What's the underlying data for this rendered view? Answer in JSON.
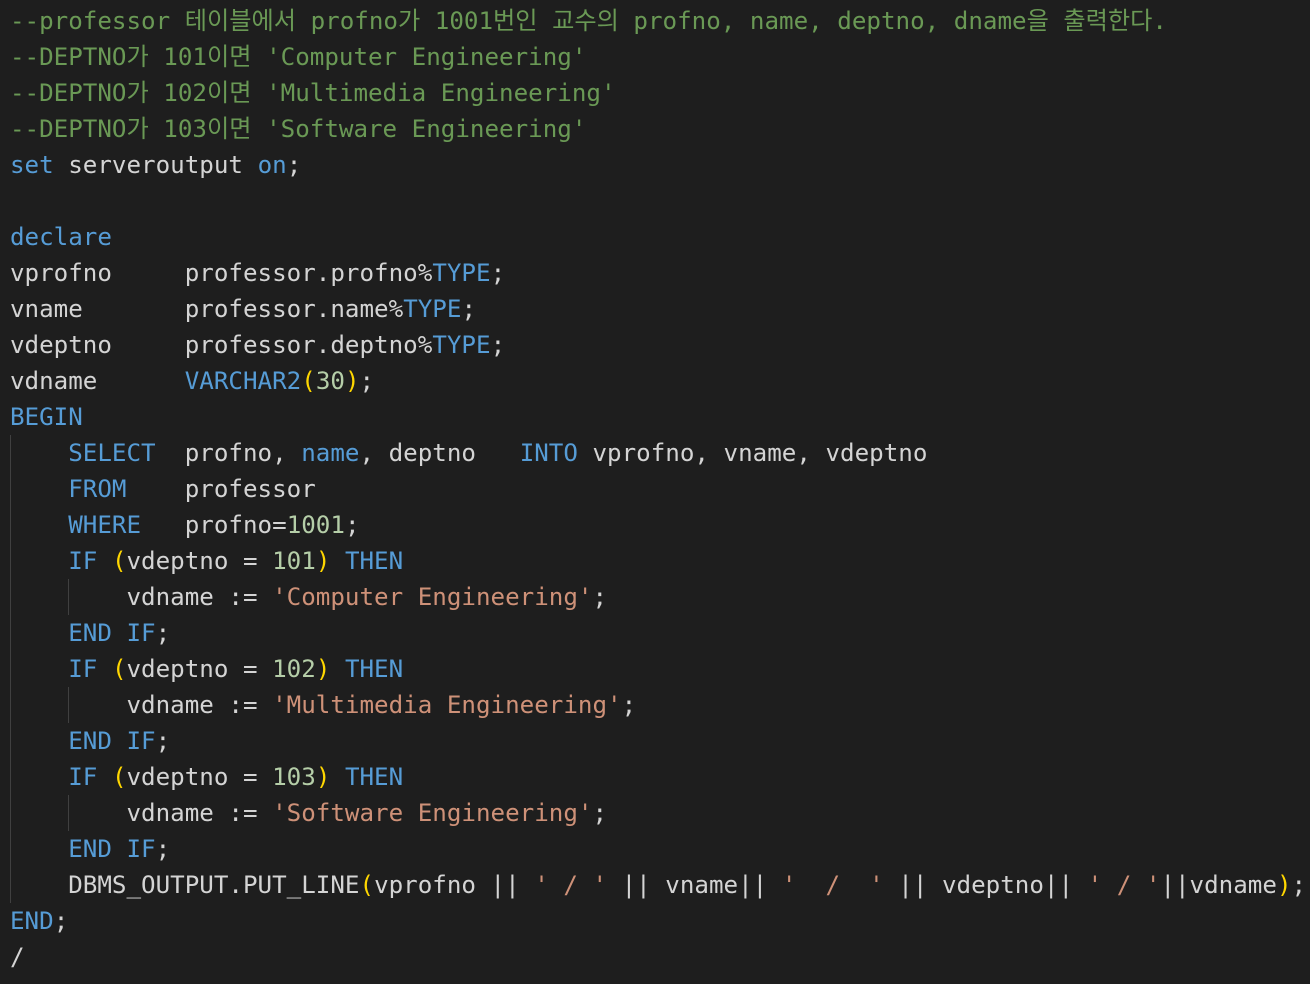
{
  "lines": [
    [
      {
        "t": "--professor 테이블에서 profno가 1001번인 교수의 profno, name, deptno, dname을 출력한다.",
        "k": "comment"
      }
    ],
    [
      {
        "t": "--DEPTNO가 101이면 'Computer Engineering'",
        "k": "comment"
      }
    ],
    [
      {
        "t": "--DEPTNO가 102이면 'Multimedia Engineering'",
        "k": "comment"
      }
    ],
    [
      {
        "t": "--DEPTNO가 103이면 'Software Engineering'",
        "k": "comment"
      }
    ],
    [
      {
        "t": "set",
        "k": "kw"
      },
      {
        "t": " serveroutput ",
        "k": "ident"
      },
      {
        "t": "on",
        "k": "kw"
      },
      {
        "t": ";",
        "k": "op"
      }
    ],
    [],
    [
      {
        "t": "declare",
        "k": "kw"
      }
    ],
    [
      {
        "t": "vprofno     professor.profno%",
        "k": "ident"
      },
      {
        "t": "TYPE",
        "k": "type"
      },
      {
        "t": ";",
        "k": "op"
      }
    ],
    [
      {
        "t": "vname       professor.name%",
        "k": "ident"
      },
      {
        "t": "TYPE",
        "k": "type"
      },
      {
        "t": ";",
        "k": "op"
      }
    ],
    [
      {
        "t": "vdeptno     professor.deptno%",
        "k": "ident"
      },
      {
        "t": "TYPE",
        "k": "type"
      },
      {
        "t": ";",
        "k": "op"
      }
    ],
    [
      {
        "t": "vdname      ",
        "k": "ident"
      },
      {
        "t": "VARCHAR2",
        "k": "type"
      },
      {
        "t": "(",
        "k": "paren"
      },
      {
        "t": "30",
        "k": "num"
      },
      {
        "t": ")",
        "k": "paren"
      },
      {
        "t": ";",
        "k": "op"
      }
    ],
    [
      {
        "t": "BEGIN",
        "k": "kw"
      }
    ],
    [
      {
        "t": "    ",
        "k": "ident"
      },
      {
        "t": "SELECT",
        "k": "kw"
      },
      {
        "t": "  profno, ",
        "k": "ident"
      },
      {
        "t": "name",
        "k": "kw"
      },
      {
        "t": ", deptno   ",
        "k": "ident"
      },
      {
        "t": "INTO",
        "k": "kw"
      },
      {
        "t": " vprofno, vname, vdeptno",
        "k": "ident"
      }
    ],
    [
      {
        "t": "    ",
        "k": "ident"
      },
      {
        "t": "FROM",
        "k": "kw"
      },
      {
        "t": "    professor",
        "k": "ident"
      }
    ],
    [
      {
        "t": "    ",
        "k": "ident"
      },
      {
        "t": "WHERE",
        "k": "kw"
      },
      {
        "t": "   profno=",
        "k": "ident"
      },
      {
        "t": "1001",
        "k": "num"
      },
      {
        "t": ";",
        "k": "op"
      }
    ],
    [
      {
        "t": "    ",
        "k": "ident"
      },
      {
        "t": "IF",
        "k": "kw"
      },
      {
        "t": " ",
        "k": "ident"
      },
      {
        "t": "(",
        "k": "paren"
      },
      {
        "t": "vdeptno = ",
        "k": "ident"
      },
      {
        "t": "101",
        "k": "num"
      },
      {
        "t": ")",
        "k": "paren"
      },
      {
        "t": " ",
        "k": "ident"
      },
      {
        "t": "THEN",
        "k": "kw"
      }
    ],
    [
      {
        "t": "        vdname := ",
        "k": "ident"
      },
      {
        "t": "'Computer Engineering'",
        "k": "str"
      },
      {
        "t": ";",
        "k": "op"
      }
    ],
    [
      {
        "t": "    ",
        "k": "ident"
      },
      {
        "t": "END",
        "k": "kw"
      },
      {
        "t": " ",
        "k": "ident"
      },
      {
        "t": "IF",
        "k": "kw"
      },
      {
        "t": ";",
        "k": "op"
      }
    ],
    [
      {
        "t": "    ",
        "k": "ident"
      },
      {
        "t": "IF",
        "k": "kw"
      },
      {
        "t": " ",
        "k": "ident"
      },
      {
        "t": "(",
        "k": "paren"
      },
      {
        "t": "vdeptno = ",
        "k": "ident"
      },
      {
        "t": "102",
        "k": "num"
      },
      {
        "t": ")",
        "k": "paren"
      },
      {
        "t": " ",
        "k": "ident"
      },
      {
        "t": "THEN",
        "k": "kw"
      }
    ],
    [
      {
        "t": "        vdname := ",
        "k": "ident"
      },
      {
        "t": "'Multimedia Engineering'",
        "k": "str"
      },
      {
        "t": ";",
        "k": "op"
      }
    ],
    [
      {
        "t": "    ",
        "k": "ident"
      },
      {
        "t": "END",
        "k": "kw"
      },
      {
        "t": " ",
        "k": "ident"
      },
      {
        "t": "IF",
        "k": "kw"
      },
      {
        "t": ";",
        "k": "op"
      }
    ],
    [
      {
        "t": "    ",
        "k": "ident"
      },
      {
        "t": "IF",
        "k": "kw"
      },
      {
        "t": " ",
        "k": "ident"
      },
      {
        "t": "(",
        "k": "paren"
      },
      {
        "t": "vdeptno = ",
        "k": "ident"
      },
      {
        "t": "103",
        "k": "num"
      },
      {
        "t": ")",
        "k": "paren"
      },
      {
        "t": " ",
        "k": "ident"
      },
      {
        "t": "THEN",
        "k": "kw"
      }
    ],
    [
      {
        "t": "        vdname := ",
        "k": "ident"
      },
      {
        "t": "'Software Engineering'",
        "k": "str"
      },
      {
        "t": ";",
        "k": "op"
      }
    ],
    [
      {
        "t": "    ",
        "k": "ident"
      },
      {
        "t": "END",
        "k": "kw"
      },
      {
        "t": " ",
        "k": "ident"
      },
      {
        "t": "IF",
        "k": "kw"
      },
      {
        "t": ";",
        "k": "op"
      }
    ],
    [
      {
        "t": "    DBMS_OUTPUT.PUT_LINE",
        "k": "fn"
      },
      {
        "t": "(",
        "k": "paren"
      },
      {
        "t": "vprofno || ",
        "k": "ident"
      },
      {
        "t": "' / '",
        "k": "str"
      },
      {
        "t": " || vname|| ",
        "k": "ident"
      },
      {
        "t": "'  /  '",
        "k": "str"
      },
      {
        "t": " || vdeptno|| ",
        "k": "ident"
      },
      {
        "t": "' / '",
        "k": "str"
      },
      {
        "t": "||vdname",
        "k": "ident"
      },
      {
        "t": ")",
        "k": "paren"
      },
      {
        "t": ";",
        "k": "op"
      }
    ],
    [
      {
        "t": "END",
        "k": "kw"
      },
      {
        "t": ";",
        "k": "op"
      }
    ],
    [
      {
        "t": "/",
        "k": "op"
      }
    ]
  ],
  "colors": {
    "background": "#1e1e1e",
    "comment": "#6a9955",
    "keyword": "#569cd6",
    "string": "#ce9178",
    "number": "#b5cea8",
    "text": "#d4d4d4",
    "bracket": "#ffd700",
    "indent_guide": "#404040"
  }
}
